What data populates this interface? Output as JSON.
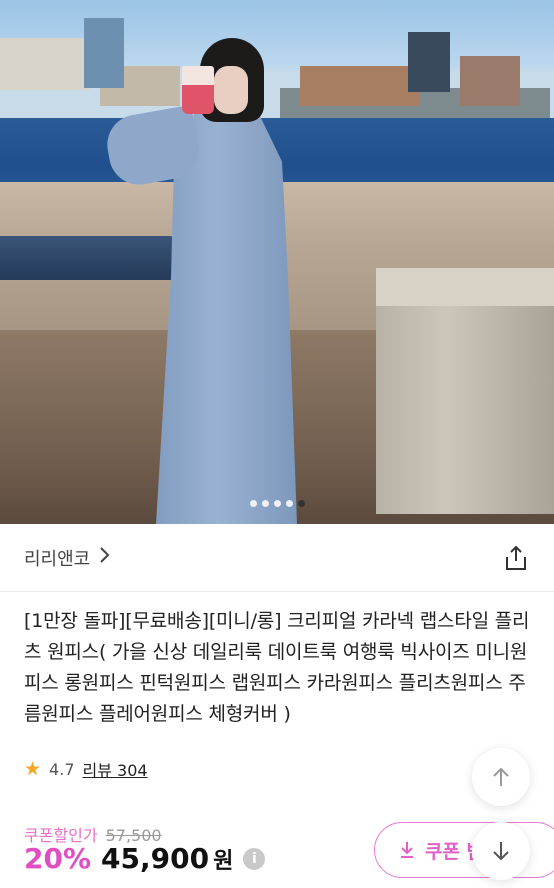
{
  "brand": {
    "name": "리리앤코"
  },
  "product": {
    "title": "[1만장 돌파][무료배송][미니/롱] 크리피얼 카라넥 랩스타일 플리츠 원피스( 가을 신상 데일리룩 데이트룩 여행룩 빅사이즈 미니원피스 롱원피스 핀턱원피스 랩원피스 카라원피스 플리츠원피스 주름원피스 플레어원피스 체형커버 )",
    "rating": "4.7",
    "review_label": "리뷰 304"
  },
  "price": {
    "coupon_label": "쿠폰할인가",
    "original": "57,500",
    "discount": "20%",
    "final": "45,900",
    "currency": "원",
    "info_icon": "i"
  },
  "coupon_button": {
    "label": "쿠폰 받"
  },
  "carousel": {
    "count": 5,
    "active_index": 4
  },
  "icons": {
    "share": "share-icon",
    "scroll_top": "arrow-up-icon",
    "scroll_down": "arrow-down-icon",
    "download": "download-icon",
    "chevron": "chevron-right-icon"
  },
  "colors": {
    "accent": "#e04fc2",
    "star": "#f5a623"
  }
}
